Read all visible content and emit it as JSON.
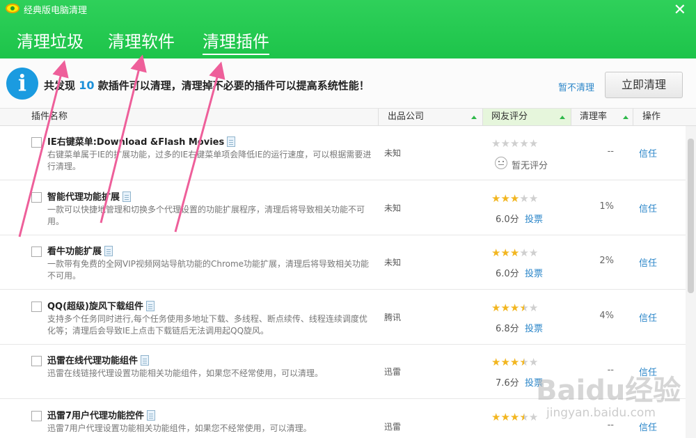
{
  "window": {
    "title": "经典版电脑清理"
  },
  "tabs": [
    {
      "label": "清理垃圾"
    },
    {
      "label": "清理软件"
    },
    {
      "label": "清理插件"
    }
  ],
  "info": {
    "prefix": "共发现",
    "count": "10",
    "suffix": "款插件可以清理，清理掉不必要的插件可以提高系统性能！",
    "skip_label": "暂不清理",
    "clean_label": "立即清理"
  },
  "columns": {
    "name": "插件名称",
    "company": "出品公司",
    "rating": "网友评分",
    "rate": "清理率",
    "action": "操作"
  },
  "rows": [
    {
      "name": "IE右键菜单:Download &Flash Movies",
      "desc": "右键菜单属于IE的扩展功能，过多的IE右键菜单项会降低IE的运行速度，可以根据需要进行清理。",
      "company": "未知",
      "stars": 0,
      "score": "暂无评分",
      "vote": "",
      "rate": "--",
      "action": "信任"
    },
    {
      "name": "智能代理功能扩展",
      "desc": "一款可以快捷地管理和切换多个代理设置的功能扩展程序，清理后将导致相关功能不可用。",
      "company": "未知",
      "stars": 3,
      "score": "6.0分",
      "vote": "投票",
      "rate": "1%",
      "action": "信任"
    },
    {
      "name": "看牛功能扩展",
      "desc": "一款带有免费的全网VIP视频网站导航功能的Chrome功能扩展，清理后将导致相关功能不可用。",
      "company": "未知",
      "stars": 3,
      "score": "6.0分",
      "vote": "投票",
      "rate": "2%",
      "action": "信任"
    },
    {
      "name": "QQ(超级)旋风下载组件",
      "desc": "支持多个任务同时进行,每个任务使用多地址下载、多线程、断点续传、线程连续调度优化等；清理后会导致IE上点击下载链后无法调用起QQ旋风。",
      "company": "腾讯",
      "stars": 3.5,
      "score": "6.8分",
      "vote": "投票",
      "rate": "4%",
      "action": "信任"
    },
    {
      "name": "迅雷在线代理功能组件",
      "desc": "迅雷在线链接代理设置功能相关功能组件，如果您不经常使用，可以清理。",
      "company": "迅雷",
      "stars": 3.5,
      "score": "7.6分",
      "vote": "投票",
      "rate": "--",
      "action": "信任"
    },
    {
      "name": "迅雷7用户代理功能控件",
      "desc": "迅雷7用户代理设置功能相关功能组件，如果您不经常使用，可以清理。",
      "company": "迅雷",
      "stars": 3.5,
      "score": "",
      "vote": "",
      "rate": "--",
      "action": "信任"
    }
  ],
  "watermark": {
    "main": "Baidu经验",
    "sub": "jingyan.baidu.com"
  },
  "colors": {
    "header_green": "#1dc44a",
    "link_blue": "#2b86c9",
    "star_gold": "#f2b620",
    "annotation_pink": "#ee5f9a"
  }
}
